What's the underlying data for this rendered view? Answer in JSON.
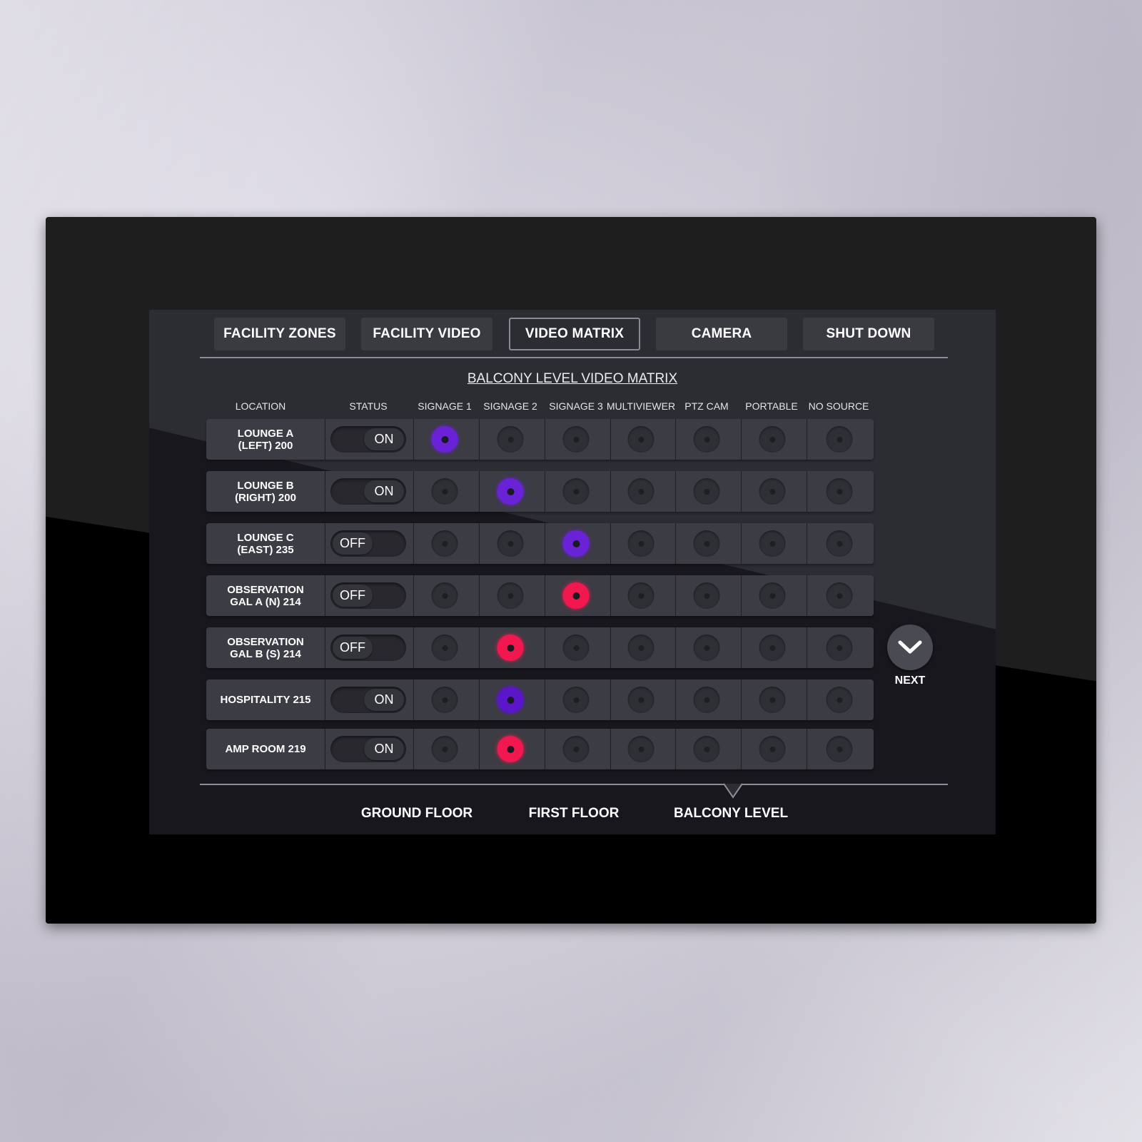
{
  "tabs": [
    {
      "label": "FACILITY ZONES",
      "active": false
    },
    {
      "label": "FACILITY VIDEO",
      "active": false
    },
    {
      "label": "VIDEO MATRIX",
      "active": true
    },
    {
      "label": "CAMERA",
      "active": false
    },
    {
      "label": "SHUT DOWN",
      "active": false
    }
  ],
  "matrix_title": "BALCONY LEVEL VIDEO MATRIX",
  "columns": {
    "location": "LOCATION",
    "status": "STATUS",
    "sources": [
      "SIGNAGE 1",
      "SIGNAGE 2",
      "SIGNAGE 3",
      "MULTIVIEWER",
      "PTZ CAM",
      "PORTABLE",
      "NO SOURCE"
    ]
  },
  "rows": [
    {
      "location": "LOUNGE A\n(LEFT) 200",
      "status": "ON",
      "selected_source": "SIGNAGE 1",
      "indicator_color": "#6a22d6"
    },
    {
      "location": "LOUNGE B\n(RIGHT) 200",
      "status": "ON",
      "selected_source": "SIGNAGE 2",
      "indicator_color": "#6a22d6"
    },
    {
      "location": "LOUNGE C\n(EAST)  235",
      "status": "OFF",
      "selected_source": "SIGNAGE 3",
      "indicator_color": "#6a22d6"
    },
    {
      "location": "OBSERVATION\nGAL A (N) 214",
      "status": "OFF",
      "selected_source": "SIGNAGE 3",
      "indicator_color": "#f0184e"
    },
    {
      "location": "OBSERVATION\nGAL B (S) 214",
      "status": "OFF",
      "selected_source": "SIGNAGE 2",
      "indicator_color": "#f0184e"
    },
    {
      "location": "HOSPITALITY 215",
      "status": "ON",
      "selected_source": "SIGNAGE 2",
      "indicator_color": "#5a16c8"
    },
    {
      "location": "AMP ROOM 219",
      "status": "ON",
      "selected_source": "SIGNAGE 2",
      "indicator_color": "#f0184e"
    }
  ],
  "next": {
    "label": "NEXT",
    "icon": "chevron-down-icon"
  },
  "floors": [
    {
      "label": "GROUND FLOOR",
      "active": false
    },
    {
      "label": "FIRST FLOOR",
      "active": false
    },
    {
      "label": "BALCONY LEVEL",
      "active": true
    }
  ]
}
